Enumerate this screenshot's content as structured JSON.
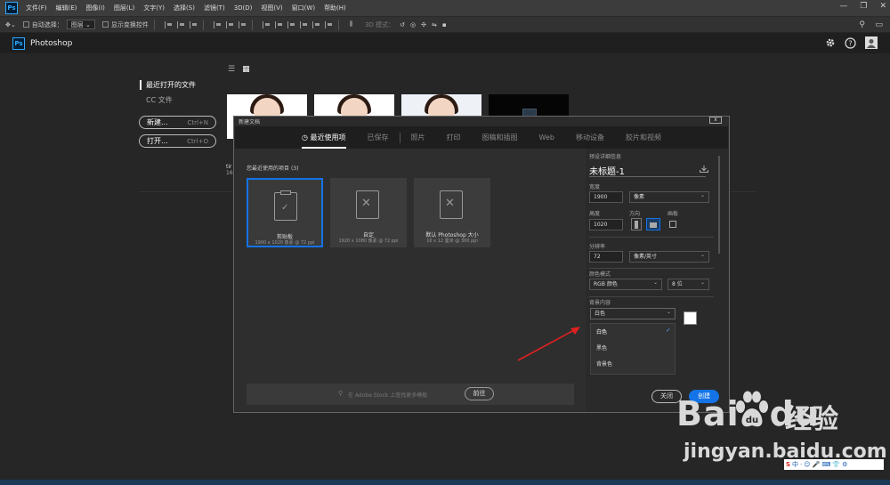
{
  "menubar": {
    "logo": "Ps",
    "items": [
      "文件(F)",
      "编辑(E)",
      "图像(I)",
      "图层(L)",
      "文字(Y)",
      "选择(S)",
      "滤镜(T)",
      "3D(D)",
      "视图(V)",
      "窗口(W)",
      "帮助(H)"
    ],
    "window_controls": [
      "—",
      "❐",
      "✕"
    ]
  },
  "options_bar": {
    "auto_select_label": "自动选择：",
    "auto_select_value": "图层",
    "show_transform_label": "显示变换控件",
    "mode_label": "3D 模式："
  },
  "home_bar": {
    "logo": "Ps",
    "title": "Photoshop"
  },
  "home": {
    "recent_label": "最近打开的文件",
    "cc_label": "CC 文件",
    "new_button": "新建...",
    "new_shortcut": "Ctrl+N",
    "open_button": "打开...",
    "open_shortcut": "Ctrl+O",
    "thumb_name_partial": "tir",
    "thumb_size_partial": "16"
  },
  "dialog": {
    "title": "新建文档",
    "close": "x",
    "tabs": [
      "最近使用项",
      "已保存",
      "照片",
      "打印",
      "图稿和插图",
      "Web",
      "移动设备",
      "胶片和视频"
    ],
    "active_tab": "最近使用项",
    "recent_label": "您最近使用的项目",
    "recent_count": "(3)",
    "cards": [
      {
        "name": "剪贴板",
        "desc": "1900 x 1020 像素 @ 72 ppi"
      },
      {
        "name": "自定",
        "desc": "1920 x 1080 像素 @ 72 ppi"
      },
      {
        "name": "默认 Photoshop 大小",
        "desc": "16 x 12 厘米 @ 300 ppi"
      }
    ],
    "search_placeholder": "在 Adobe Stock 上查找更多模板",
    "go_button": "前往",
    "preset_details_label": "预设详细信息",
    "doc_title": "未标题-1",
    "width_label": "宽度",
    "width_value": "1900",
    "width_unit": "像素",
    "height_label": "高度",
    "height_value": "1020",
    "orientation_label": "方向",
    "artboard_label": "画板",
    "resolution_label": "分辨率",
    "resolution_value": "72",
    "resolution_unit": "像素/英寸",
    "color_mode_label": "颜色模式",
    "color_mode_value": "RGB 颜色",
    "bit_depth_value": "8 位",
    "bg_label": "背景内容",
    "bg_value": "白色",
    "bg_options": [
      "白色",
      "黑色",
      "背景色"
    ],
    "bg_checkmark": "✓",
    "close_button": "关闭",
    "create_button": "创建"
  },
  "watermark": {
    "brand": "Bai",
    "brand2": "du",
    "cn": "经验",
    "url": "jingyan.baidu.com"
  },
  "tray": {
    "items": [
      "S",
      "中",
      "·",
      "☺",
      "🎤",
      "⌨",
      "👕",
      "⚙"
    ]
  },
  "colors": {
    "accent": "#1473e6",
    "ps_blue": "#31a8ff",
    "arrow": "#e02020"
  }
}
